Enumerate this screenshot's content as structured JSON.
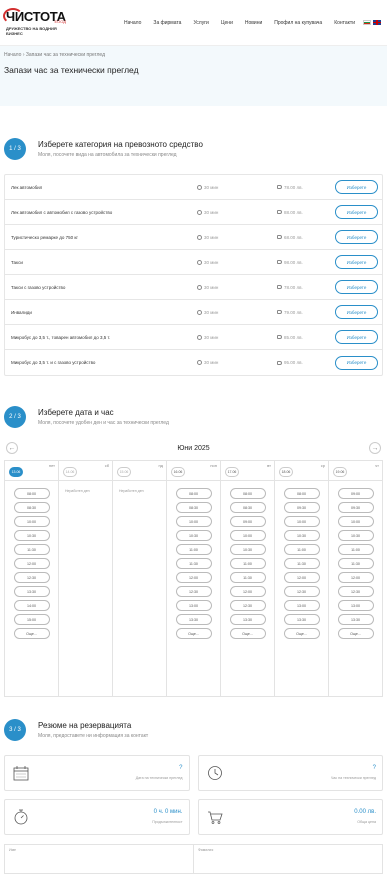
{
  "brand": {
    "name": "ЧИСТОТА",
    "suffix": "ЕООД",
    "tagline": "ДРУЖЕСТВО НА ВОДНИЯ БИЗНЕС"
  },
  "nav": [
    "Начало",
    "За фирмата",
    "Услуги",
    "Цени",
    "Новини",
    "Профил на купувача",
    "Контакти"
  ],
  "breadcrumb": {
    "home": "Начало",
    "sep": "›",
    "current": "Запази час за технически преглед"
  },
  "page_title": "Запази час за технически преглед",
  "step1": {
    "num": "1 / 3",
    "title": "Изберете категория на превозното средство",
    "subtitle": "Моля, посочете вида на автомобила за технически преглед"
  },
  "categories": [
    {
      "name": "Лек автомобил",
      "duration": "30 мин",
      "price": "78.00 лв.",
      "button": "Изберете"
    },
    {
      "name": "Лек автомобил с автомобил с газово устройство",
      "duration": "30 мин",
      "price": "88.00 лв.",
      "button": "Изберете"
    },
    {
      "name": "Туристическо ремарке до 750 кг",
      "duration": "30 мин",
      "price": "68.00 лв.",
      "button": "Изберете"
    },
    {
      "name": "Такси",
      "duration": "30 мин",
      "price": "98.00 лв.",
      "button": "Изберете"
    },
    {
      "name": "Такси с газово устройство",
      "duration": "30 мин",
      "price": "78.00 лв.",
      "button": "Изберете"
    },
    {
      "name": "Инвалиди",
      "duration": "30 мин",
      "price": "79.00 лв.",
      "button": "Изберете"
    },
    {
      "name": "Микробус до 3,5 т., товарен автомобил до 3,5 т.",
      "duration": "30 мин",
      "price": "85.00 лв.",
      "button": "Изберете"
    },
    {
      "name": "Микробус до 3,5 т. и с газово устройство",
      "duration": "30 мин",
      "price": "95.00 лв.",
      "button": "Изберете"
    }
  ],
  "step2": {
    "num": "2 / 3",
    "title": "Изберете дата и час",
    "subtitle": "Моля, посочете удобен ден и час за технически преглед"
  },
  "calendar": {
    "month": "Юни 2025",
    "prev": "←",
    "next": "→",
    "days": [
      {
        "date": "13.06",
        "dow": "пет",
        "state": "active",
        "slots": [
          "08:00",
          "08:30",
          "10:00",
          "10:30",
          "11:30",
          "12:00",
          "12:30",
          "13:30",
          "14:00",
          "15:00",
          "Още..."
        ]
      },
      {
        "date": "14.06",
        "dow": "сб",
        "state": "past",
        "closed": "Неработен ден"
      },
      {
        "date": "15.06",
        "dow": "нд",
        "state": "past",
        "closed": "Неработен ден"
      },
      {
        "date": "16.06",
        "dow": "пон",
        "state": "normal",
        "slots": [
          "08:00",
          "08:30",
          "10:00",
          "10:30",
          "11:00",
          "11:30",
          "12:00",
          "12:30",
          "13:00",
          "13:30",
          "Още..."
        ]
      },
      {
        "date": "17.06",
        "dow": "вт",
        "state": "normal",
        "slots": [
          "08:00",
          "08:30",
          "09:00",
          "10:00",
          "10:30",
          "11:00",
          "11:30",
          "12:00",
          "12:30",
          "13:30",
          "Още..."
        ]
      },
      {
        "date": "18.06",
        "dow": "ср",
        "state": "normal",
        "slots": [
          "08:00",
          "09:30",
          "10:00",
          "10:30",
          "11:00",
          "11:30",
          "12:00",
          "12:30",
          "13:00",
          "13:30",
          "Още..."
        ]
      },
      {
        "date": "19.06",
        "dow": "чт",
        "state": "normal",
        "slots": [
          "09:00",
          "09:30",
          "10:00",
          "10:30",
          "11:00",
          "11:30",
          "12:00",
          "12:30",
          "13:00",
          "13:30",
          "Още..."
        ]
      }
    ]
  },
  "step3": {
    "num": "3 / 3",
    "title": "Резюме на резервацията",
    "subtitle": "Моля, предоставете ни информация за контакт"
  },
  "summary": {
    "date": {
      "value": "?",
      "label": "Дата на технически преглед"
    },
    "time": {
      "value": "?",
      "label": "Час на технически преглед"
    },
    "duration": {
      "value": "0 ч. 0 мин.",
      "label": "Продължителност"
    },
    "total": {
      "value": "0.00 лв.",
      "label": "Обща цена"
    }
  },
  "form": {
    "name_label": "Име",
    "surname_label": "Фамилия"
  },
  "colors": {
    "accent": "#2a8fc9",
    "brand_red": "#d32f2f"
  }
}
